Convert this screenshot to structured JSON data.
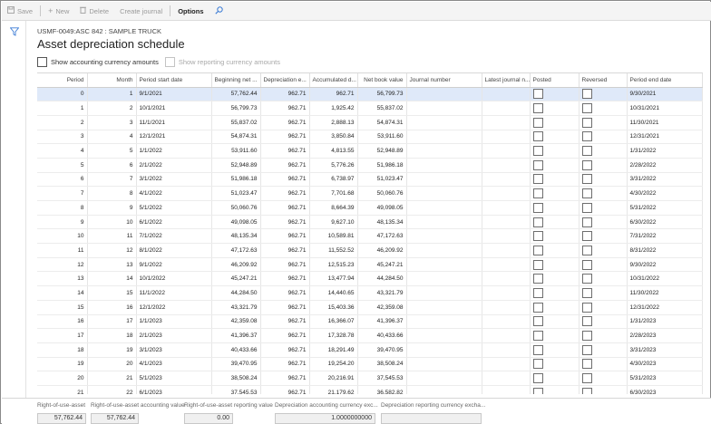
{
  "toolbar": {
    "save": "Save",
    "new": "New",
    "delete": "Delete",
    "create_journal": "Create journal",
    "options": "Options"
  },
  "header": {
    "subtitle": "USMF-0049:ASC 842 : SAMPLE TRUCK",
    "title": "Asset depreciation schedule",
    "show_accounting": "Show accounting currency amounts",
    "show_reporting": "Show reporting currency amounts"
  },
  "grid": {
    "columns": [
      "Period",
      "Month",
      "Period start date",
      "Beginning net ...",
      "Depreciation e...",
      "Accumulated d...",
      "Net book value",
      "Journal number",
      "Latest journal n...",
      "Posted",
      "Reversed",
      "Period end date"
    ],
    "rows": [
      [
        "0",
        "1",
        "9/1/2021",
        "57,762.44",
        "962.71",
        "962.71",
        "56,799.73",
        "",
        "",
        "",
        "",
        "9/30/2021"
      ],
      [
        "1",
        "2",
        "10/1/2021",
        "56,799.73",
        "962.71",
        "1,925.42",
        "55,837.02",
        "",
        "",
        "",
        "",
        "10/31/2021"
      ],
      [
        "2",
        "3",
        "11/1/2021",
        "55,837.02",
        "962.71",
        "2,888.13",
        "54,874.31",
        "",
        "",
        "",
        "",
        "11/30/2021"
      ],
      [
        "3",
        "4",
        "12/1/2021",
        "54,874.31",
        "962.71",
        "3,850.84",
        "53,911.60",
        "",
        "",
        "",
        "",
        "12/31/2021"
      ],
      [
        "4",
        "5",
        "1/1/2022",
        "53,911.60",
        "962.71",
        "4,813.55",
        "52,948.89",
        "",
        "",
        "",
        "",
        "1/31/2022"
      ],
      [
        "5",
        "6",
        "2/1/2022",
        "52,948.89",
        "962.71",
        "5,776.26",
        "51,986.18",
        "",
        "",
        "",
        "",
        "2/28/2022"
      ],
      [
        "6",
        "7",
        "3/1/2022",
        "51,986.18",
        "962.71",
        "6,738.97",
        "51,023.47",
        "",
        "",
        "",
        "",
        "3/31/2022"
      ],
      [
        "7",
        "8",
        "4/1/2022",
        "51,023.47",
        "962.71",
        "7,701.68",
        "50,060.76",
        "",
        "",
        "",
        "",
        "4/30/2022"
      ],
      [
        "8",
        "9",
        "5/1/2022",
        "50,060.76",
        "962.71",
        "8,664.39",
        "49,098.05",
        "",
        "",
        "",
        "",
        "5/31/2022"
      ],
      [
        "9",
        "10",
        "6/1/2022",
        "49,098.05",
        "962.71",
        "9,627.10",
        "48,135.34",
        "",
        "",
        "",
        "",
        "6/30/2022"
      ],
      [
        "10",
        "11",
        "7/1/2022",
        "48,135.34",
        "962.71",
        "10,589.81",
        "47,172.63",
        "",
        "",
        "",
        "",
        "7/31/2022"
      ],
      [
        "11",
        "12",
        "8/1/2022",
        "47,172.63",
        "962.71",
        "11,552.52",
        "46,209.92",
        "",
        "",
        "",
        "",
        "8/31/2022"
      ],
      [
        "12",
        "13",
        "9/1/2022",
        "46,209.92",
        "962.71",
        "12,515.23",
        "45,247.21",
        "",
        "",
        "",
        "",
        "9/30/2022"
      ],
      [
        "13",
        "14",
        "10/1/2022",
        "45,247.21",
        "962.71",
        "13,477.94",
        "44,284.50",
        "",
        "",
        "",
        "",
        "10/31/2022"
      ],
      [
        "14",
        "15",
        "11/1/2022",
        "44,284.50",
        "962.71",
        "14,440.65",
        "43,321.79",
        "",
        "",
        "",
        "",
        "11/30/2022"
      ],
      [
        "15",
        "16",
        "12/1/2022",
        "43,321.79",
        "962.71",
        "15,403.36",
        "42,359.08",
        "",
        "",
        "",
        "",
        "12/31/2022"
      ],
      [
        "16",
        "17",
        "1/1/2023",
        "42,359.08",
        "962.71",
        "16,366.07",
        "41,396.37",
        "",
        "",
        "",
        "",
        "1/31/2023"
      ],
      [
        "17",
        "18",
        "2/1/2023",
        "41,396.37",
        "962.71",
        "17,328.78",
        "40,433.66",
        "",
        "",
        "",
        "",
        "2/28/2023"
      ],
      [
        "18",
        "19",
        "3/1/2023",
        "40,433.66",
        "962.71",
        "18,291.49",
        "39,470.95",
        "",
        "",
        "",
        "",
        "3/31/2023"
      ],
      [
        "19",
        "20",
        "4/1/2023",
        "39,470.95",
        "962.71",
        "19,254.20",
        "38,508.24",
        "",
        "",
        "",
        "",
        "4/30/2023"
      ],
      [
        "20",
        "21",
        "5/1/2023",
        "38,508.24",
        "962.71",
        "20,216.91",
        "37,545.53",
        "",
        "",
        "",
        "",
        "5/31/2023"
      ],
      [
        "21",
        "22",
        "6/1/2023",
        "37,545.53",
        "962.71",
        "21,179.62",
        "36,582.82",
        "",
        "",
        "",
        "",
        "6/30/2023"
      ]
    ]
  },
  "footer": {
    "labels": [
      "Right-of-use-asset",
      "Right-of-use-asset accounting value",
      "Right-of-use-asset reporting value",
      "Depreciation accounting currency exc...",
      "Depreciation reporting currency excha..."
    ],
    "values": [
      "57,762.44",
      "57,762.44",
      "0.00",
      "1.0000000000",
      ""
    ]
  },
  "colors": {
    "accent": "#3a7bd5",
    "selected_row": "#dfe9f9"
  },
  "icons": [
    "save-icon",
    "plus-icon",
    "trash-icon",
    "search-icon",
    "filter-icon"
  ]
}
